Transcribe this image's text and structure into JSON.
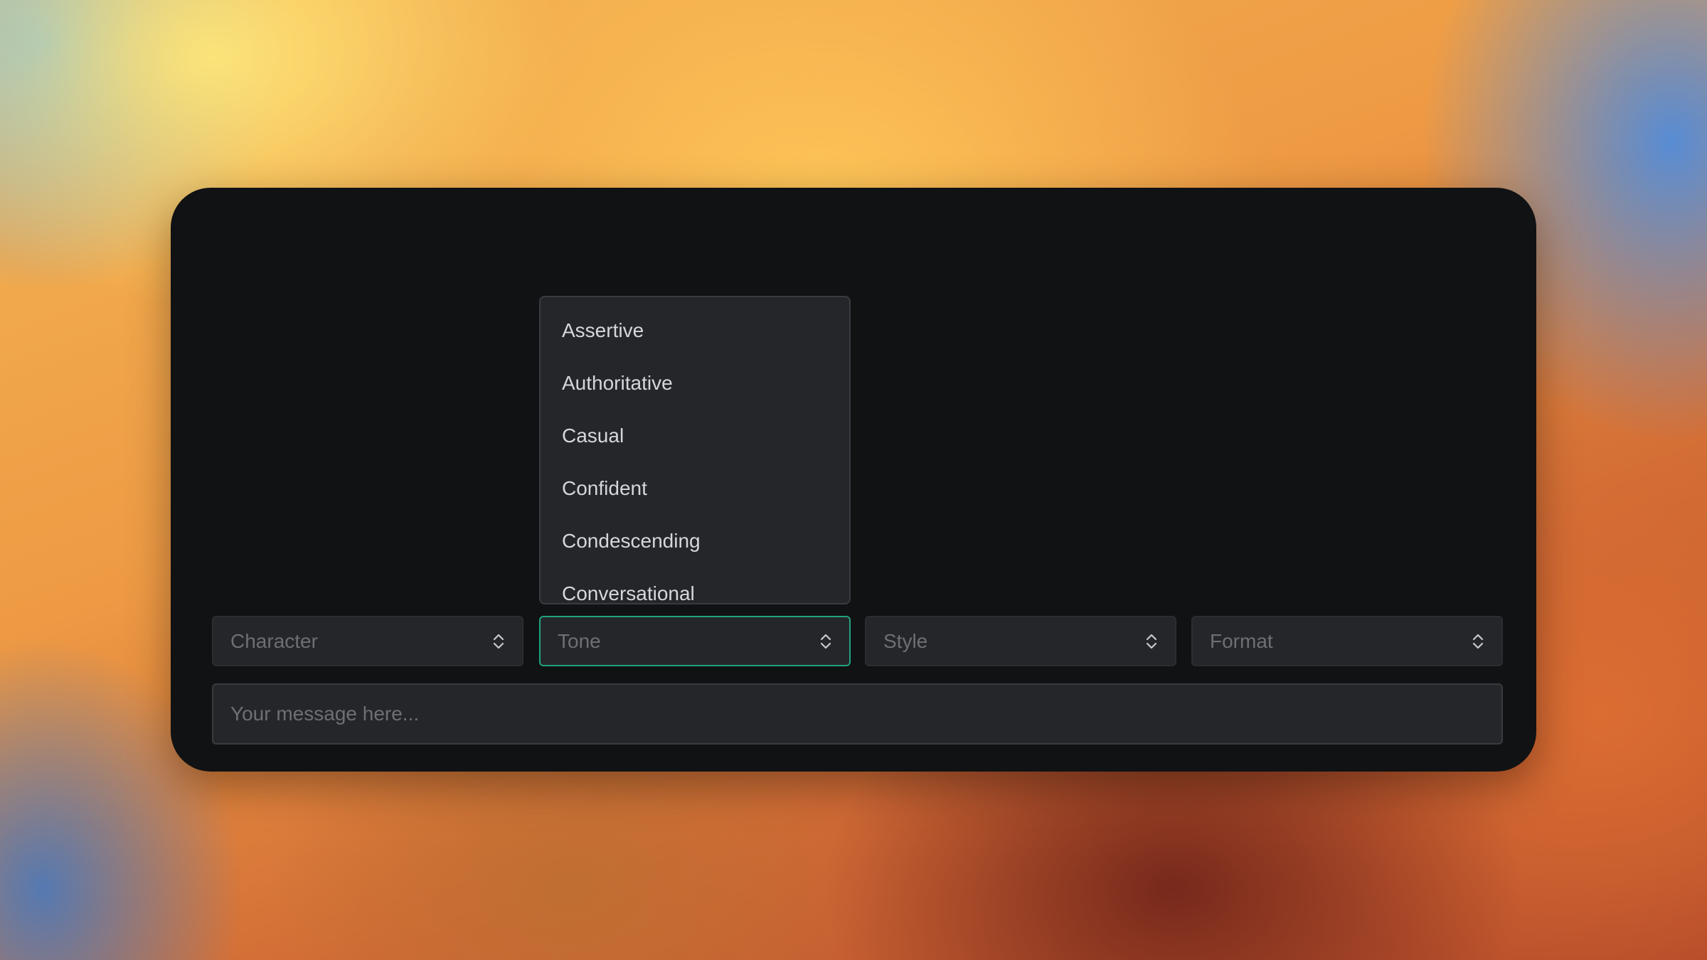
{
  "tone_menu": {
    "options": [
      "Assertive",
      "Authoritative",
      "Casual",
      "Confident",
      "Condescending",
      "Conversational"
    ]
  },
  "selects": {
    "character": {
      "placeholder": "Character",
      "icon": "chevron-up-down-icon"
    },
    "tone": {
      "placeholder": "Tone",
      "icon": "chevron-up-down-icon",
      "focused": true,
      "focus_color": "#20a37f"
    },
    "style": {
      "placeholder": "Style",
      "icon": "chevron-up-down-icon"
    },
    "format": {
      "placeholder": "Format",
      "icon": "chevron-up-down-icon"
    }
  },
  "message": {
    "placeholder": "Your message here..."
  }
}
